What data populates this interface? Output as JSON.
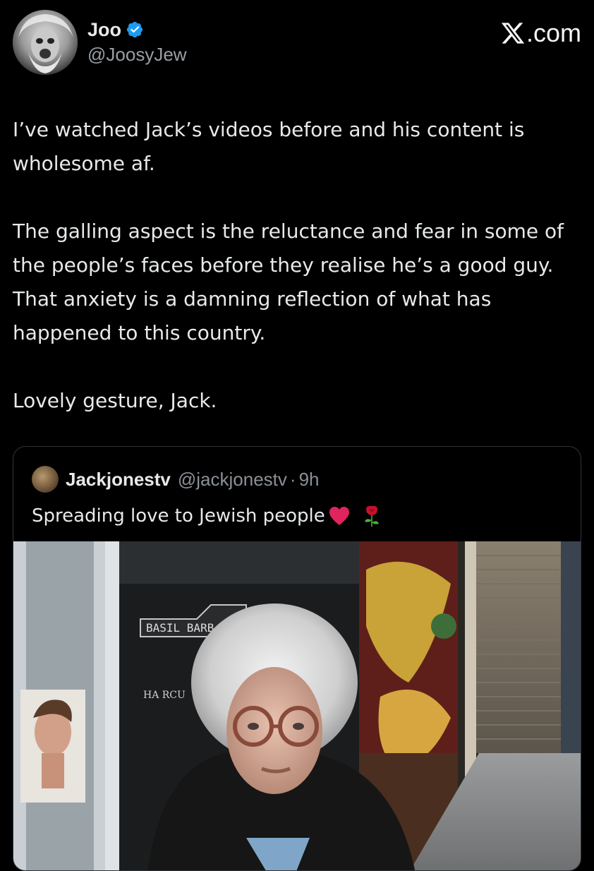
{
  "author": {
    "display_name": "Joo",
    "handle": "@JoosyJew",
    "verified": true,
    "avatar_icon": "avatar-photo"
  },
  "brand": {
    "label": ".com",
    "icon": "x-logo-icon"
  },
  "tweet": {
    "paragraphs": [
      "I’ve watched Jack’s videos before and his content is wholesome af.",
      "The galling aspect is the reluctance and fear in some of the people’s faces before they realise he’s a good guy. That anxiety is a damning reflection of what has happened to this country.",
      "Lovely gesture, Jack."
    ]
  },
  "quoted_tweet": {
    "display_name": "Jackjonestv",
    "handle": "@jackjonestv",
    "separator": "·",
    "time": "9h",
    "text": "Spreading love to Jewish people",
    "emojis": [
      "red-heart-icon",
      "rose-icon"
    ],
    "media": {
      "type": "video-thumbnail",
      "storefront_sign": "BASIL BARB",
      "window_text": "HA RCU"
    }
  },
  "colors": {
    "background": "#000000",
    "text": "#e7e9ea",
    "secondary_text": "#8b9096",
    "verified_blue": "#1d9bf0",
    "card_border": "#2f3336"
  }
}
